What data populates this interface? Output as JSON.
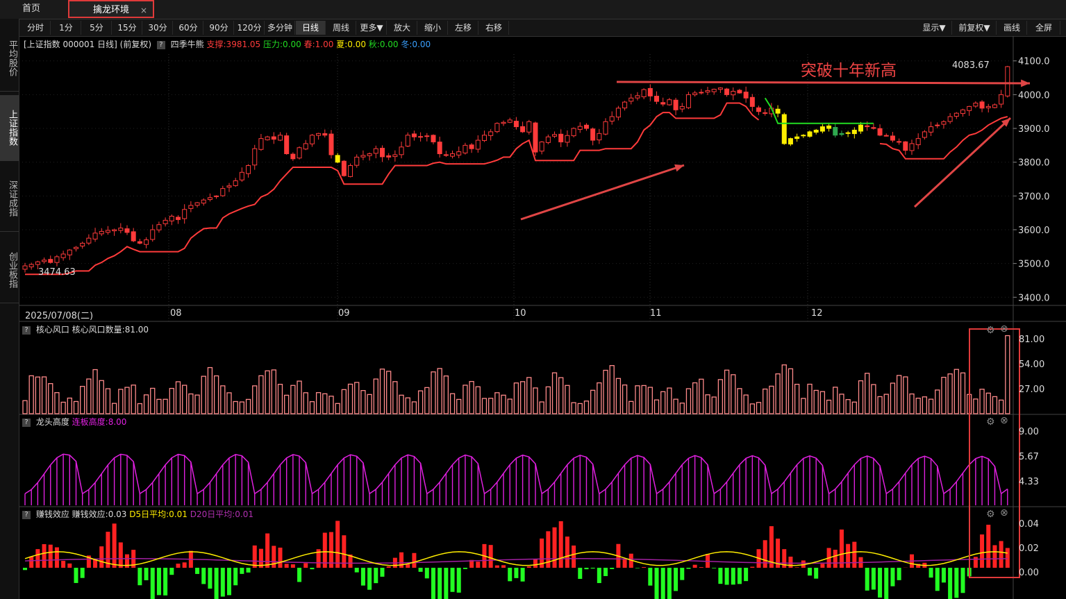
{
  "tabs": {
    "home": "首页",
    "active": "擒龙环境",
    "close": "×"
  },
  "leftnav": [
    {
      "label": "平均股价",
      "active": false
    },
    {
      "label": "上证指数",
      "active": true
    },
    {
      "label": "深证成指",
      "active": false
    },
    {
      "label": "创业板指",
      "active": false
    }
  ],
  "toolbar": {
    "periods": [
      "分时",
      "1分",
      "5分",
      "15分",
      "30分",
      "60分",
      "90分",
      "120分",
      "多分钟",
      "日线",
      "周线",
      "更多▼",
      "放大",
      "缩小",
      "左移",
      "右移"
    ],
    "active_period": "日线",
    "right": [
      "显示▼",
      "前复权▼",
      "画线",
      "全屏"
    ]
  },
  "info": {
    "symbol": "[上证指数 000001 日线]",
    "adj": "(前复权)",
    "indicator": "四季牛熊",
    "support": "支撑:3981.05",
    "pressure": "压力:0.00",
    "spring": "春:1.00",
    "summer": "夏:0.00",
    "autumn": "秋:0.00",
    "winter": "冬:0.00"
  },
  "annotation": {
    "text": "突破十年新高",
    "high_label": "4083.67",
    "low_label": "3474.63"
  },
  "x_axis": {
    "start": "2025/07/08(二)",
    "months": [
      "08",
      "09",
      "10",
      "11",
      "12"
    ]
  },
  "panels": {
    "p1": {
      "name": "核心风口",
      "label": "核心风口数量:81.00",
      "ticks": [
        "81.00",
        "54.00",
        "27.00"
      ]
    },
    "p2": {
      "name": "龙头高度",
      "label": "连板高度:8.00",
      "ticks": [
        "9.00",
        "5.67",
        "4.33"
      ]
    },
    "p3": {
      "name": "赚钱效应",
      "label": "赚钱效应:0.03",
      "d5": "D5日平均:0.01",
      "d20": "D20日平均:0.01",
      "ticks": [
        "0.04",
        "0.02",
        "0.00"
      ]
    }
  },
  "colors": {
    "up": "#ff3b3b",
    "down": "#ffee00",
    "green": "#22dd22",
    "magenta": "#e020e0",
    "pink_bar": "#ff8a8a",
    "highlight": "#e03a3a"
  },
  "chart_data": {
    "type": "candlestick",
    "ylim": [
      3380,
      4120
    ],
    "y_ticks": [
      3400,
      3500,
      3600,
      3700,
      3800,
      3900,
      4000,
      4100
    ],
    "close": [
      3493,
      3497,
      3505,
      3510,
      3503,
      3520,
      3528,
      3540,
      3548,
      3560,
      3575,
      3590,
      3595,
      3598,
      3600,
      3605,
      3592,
      3567,
      3560,
      3570,
      3600,
      3615,
      3628,
      3640,
      3630,
      3660,
      3672,
      3680,
      3688,
      3695,
      3700,
      3722,
      3730,
      3745,
      3770,
      3790,
      3840,
      3870,
      3875,
      3868,
      3880,
      3825,
      3810,
      3843,
      3855,
      3880,
      3885,
      3880,
      3822,
      3800,
      3760,
      3790,
      3815,
      3820,
      3825,
      3840,
      3816,
      3815,
      3822,
      3845,
      3880,
      3875,
      3876,
      3878,
      3860,
      3825,
      3820,
      3825,
      3831,
      3850,
      3840,
      3865,
      3880,
      3890,
      3915,
      3918,
      3925,
      3905,
      3890,
      3920,
      3830,
      3860,
      3875,
      3882,
      3860,
      3879,
      3900,
      3906,
      3900,
      3865,
      3885,
      3920,
      3935,
      3960,
      3978,
      3990,
      3997,
      4015,
      3996,
      3980,
      3972,
      3985,
      3955,
      3965,
      4000,
      4005,
      4007,
      4012,
      4016,
      4020,
      4000,
      4010,
      4005,
      3990,
      3965,
      3950,
      3945,
      3960,
      3945,
      3855,
      3870,
      3875,
      3880,
      3890,
      3895,
      3905,
      3900,
      3880,
      3885,
      3885,
      3895,
      3910,
      3905,
      3900,
      3880,
      3878,
      3865,
      3860,
      3835,
      3855,
      3870,
      3890,
      3905,
      3910,
      3920,
      3935,
      3945,
      3955,
      3965,
      3975,
      3960,
      3965,
      3970,
      4000,
      4083
    ]
  }
}
